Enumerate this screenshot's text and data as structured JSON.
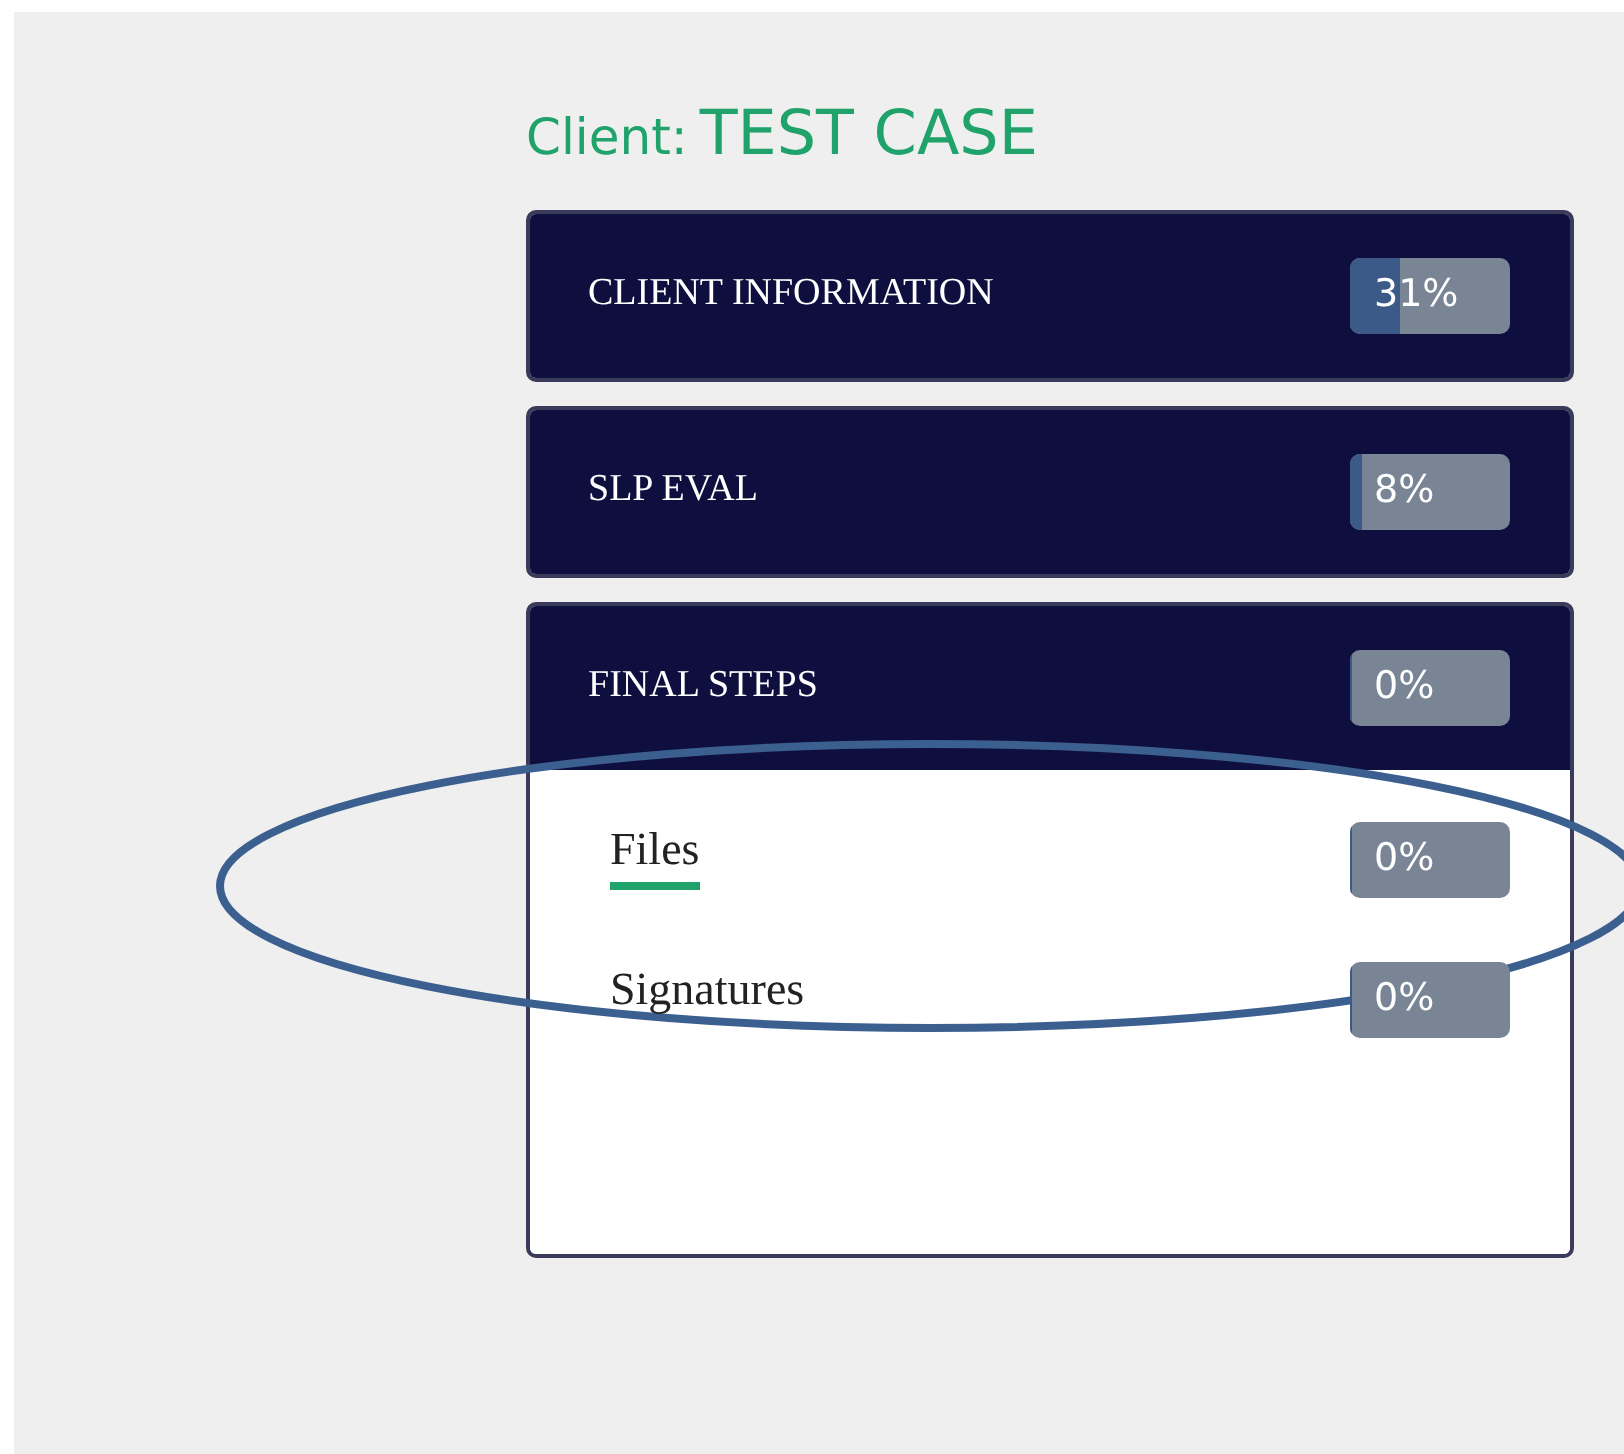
{
  "client": {
    "label": "Client:",
    "name": "TEST CASE"
  },
  "sections": [
    {
      "title": "CLIENT INFORMATION",
      "percent": "31%",
      "level": 0.31,
      "expanded": false
    },
    {
      "title": "SLP EVAL",
      "percent": "8%",
      "level": 0.08,
      "expanded": false
    },
    {
      "title": "FINAL STEPS",
      "percent": "0%",
      "level": 0,
      "expanded": true,
      "items": [
        {
          "label": "Files",
          "percent": "0%",
          "level": 0,
          "selected": true
        },
        {
          "label": "Signatures",
          "percent": "0%",
          "level": 0,
          "selected": false
        }
      ]
    }
  ]
}
